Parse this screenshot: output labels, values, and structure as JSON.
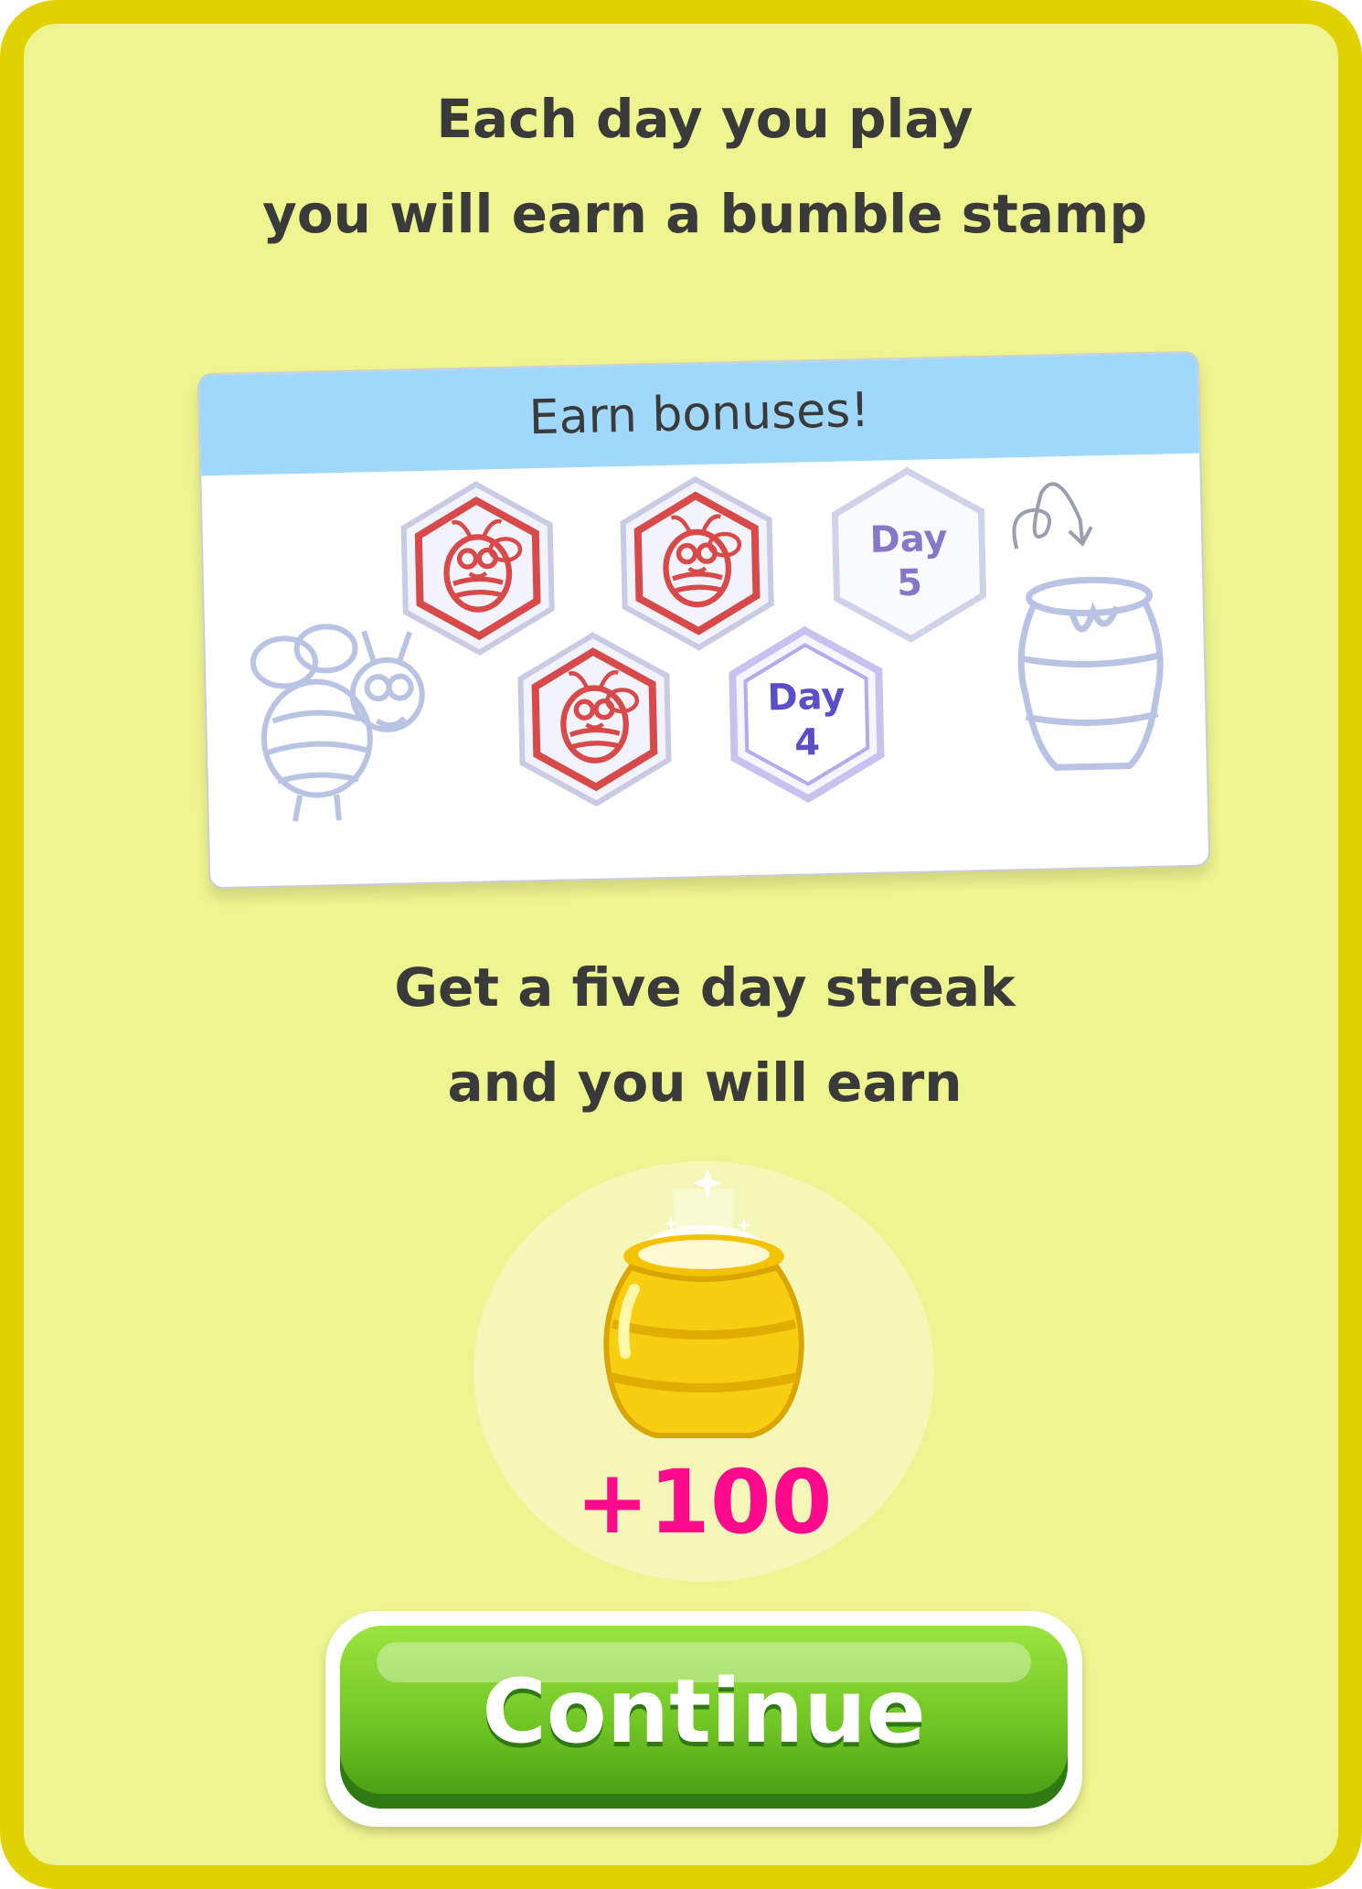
{
  "intro": {
    "line1": "Each day you play",
    "line2": "you will earn a bumble stamp"
  },
  "bonus_card": {
    "title": "Earn bonuses!",
    "stamps": [
      {
        "state": "stamped",
        "icon": "bee-stamp-icon"
      },
      {
        "state": "stamped",
        "icon": "bee-stamp-icon"
      },
      {
        "state": "stamped",
        "icon": "bee-stamp-icon"
      },
      {
        "state": "current",
        "label": "Day",
        "day": "4"
      },
      {
        "state": "upcoming",
        "label": "Day",
        "day": "5"
      }
    ],
    "decorations": [
      "bee-outline-icon",
      "honey-pot-outline-icon",
      "curly-arrow-icon"
    ]
  },
  "streak": {
    "line1": "Get a five day streak",
    "line2": "and you will earn"
  },
  "reward": {
    "icon": "honey-pot-icon",
    "amount": "+100"
  },
  "continue_button": {
    "label": "Continue"
  },
  "colors": {
    "border": "#e0d200",
    "background": "#eef48f",
    "card_header": "#9fd8fb",
    "stamp_red": "#d84a4a",
    "day_purple": "#6a5acd",
    "reward_pink": "#ff0a8c",
    "button_green": "#6fc524"
  }
}
